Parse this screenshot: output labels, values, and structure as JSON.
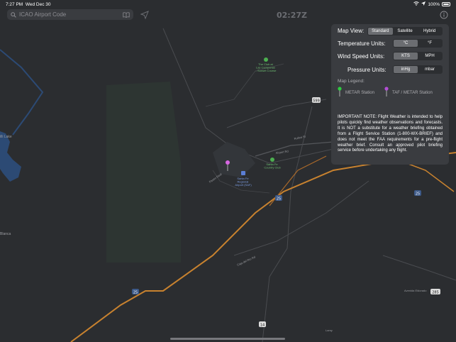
{
  "status_bar": {
    "time": "7:27 PM",
    "date": "Wed Dec 30",
    "battery": "100%"
  },
  "search": {
    "placeholder": "ICAO Airport Code",
    "value": ""
  },
  "clock": "02:27Z",
  "settings": {
    "map_view": {
      "label": "Map View:",
      "options": [
        "Standard",
        "Satellite",
        "Hybrid"
      ],
      "selected": "Standard"
    },
    "temperature": {
      "label": "Temperature Units:",
      "options": [
        "°C",
        "°F"
      ],
      "selected": "°C"
    },
    "wind": {
      "label": "Wind Speed Units:",
      "options": [
        "KTS",
        "MPH"
      ],
      "selected": "KTS"
    },
    "pressure": {
      "label": "Pressure Units:",
      "options": [
        "inHg",
        "mbar"
      ],
      "selected": "inHg"
    }
  },
  "legend": {
    "title": "Map Legend:",
    "metar": "METAR Station",
    "taf": "TAF / METAR Station",
    "metar_color": "#2ecc40",
    "taf_color": "#b44fd6"
  },
  "note": "IMPORTANT NOTE: Flight Weather is intended to help pilots quickly find weather observations and forecasts. It is NOT a substitute for a weather briefing obtained from a Flight Service Station (1-800-WX-BRIEF) and does not meet the FAA requirements for a pre-flight weather brief. Consult an approved pilot briefing service before undertaking any flight.",
  "map": {
    "labels": {
      "golf": "The Club at Las Campanas - Sunset Course",
      "country_club": "Santa Fe Country Club",
      "airport": "Santa Fe Regional Airport (SAF)",
      "lake": "illi Lake",
      "blanca": "Blanca",
      "airport_rd": "Airport Rd",
      "rufina": "Rufina St",
      "caja": "Caja del Rio Rd",
      "avenida": "Avenida Eldorado",
      "lamy": "Lamy"
    },
    "shields": {
      "i25_east": "25",
      "i25_mid": "25",
      "i25_west": "25",
      "us285": "285",
      "r599": "599",
      "r14": "14"
    },
    "colors": {
      "background": "#2b2d30",
      "highway": "#c8822f",
      "water": "#2c4a74",
      "park": "#2f4336",
      "panel": "#3a3c40"
    }
  }
}
